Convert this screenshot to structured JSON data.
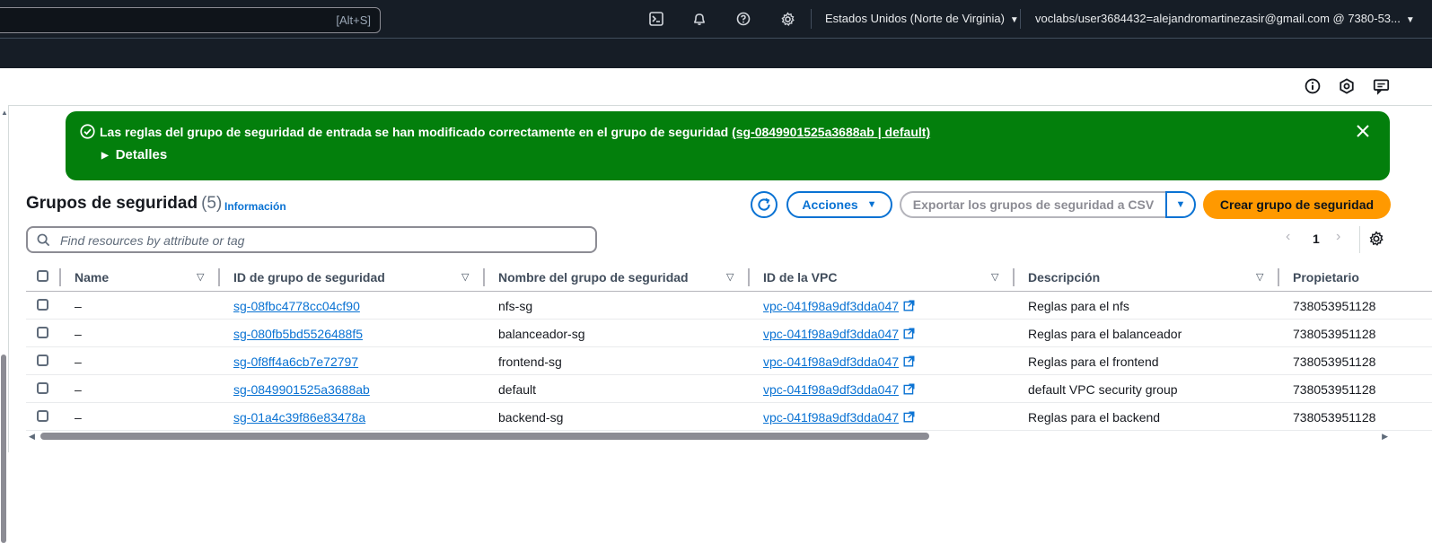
{
  "header": {
    "search_shortcut": "[Alt+S]",
    "icons": [
      "cloudshell-icon",
      "bell-icon",
      "help-icon",
      "gear-icon"
    ],
    "region": "Estados Unidos (Norte de Virginia)",
    "account": "voclabs/user3684432=alejandromartinezasir@gmail.com @ 7380-53..."
  },
  "utility_icons": [
    "info-icon",
    "hexagon-icon",
    "feedback-icon"
  ],
  "flash": {
    "message": "Las reglas del grupo de seguridad de entrada se han modificado correctamente en el grupo de seguridad",
    "link": "(sg-0849901525a3688ab | default)",
    "details": "Detalles",
    "color": "#037f0c"
  },
  "section": {
    "title": "Grupos de seguridad",
    "count": "(5)",
    "info": "Información"
  },
  "actions": {
    "acciones": "Acciones",
    "export": "Exportar los grupos de seguridad a CSV",
    "create": "Crear grupo de seguridad",
    "create_color": "#ff9900"
  },
  "filter": {
    "placeholder": "Find resources by attribute or tag"
  },
  "pagination": {
    "prev": "‹",
    "page": "1",
    "next": "›"
  },
  "table": {
    "columns": [
      "Name",
      "ID de grupo de seguridad",
      "Nombre del grupo de seguridad",
      "ID de la VPC",
      "Descripción",
      "Propietario"
    ],
    "rows": [
      {
        "name": "–",
        "id": "sg-08fbc4778cc04cf90",
        "group": "nfs-sg",
        "vpc": "vpc-041f98a9df3dda047",
        "desc": "Reglas para el nfs",
        "owner": "738053951128"
      },
      {
        "name": "–",
        "id": "sg-080fb5bd5526488f5",
        "group": "balanceador-sg",
        "vpc": "vpc-041f98a9df3dda047",
        "desc": "Reglas para el balanceador",
        "owner": "738053951128"
      },
      {
        "name": "–",
        "id": "sg-0f8ff4a6cb7e72797",
        "group": "frontend-sg",
        "vpc": "vpc-041f98a9df3dda047",
        "desc": "Reglas para el frontend",
        "owner": "738053951128"
      },
      {
        "name": "–",
        "id": "sg-0849901525a3688ab",
        "group": "default",
        "vpc": "vpc-041f98a9df3dda047",
        "desc": "default VPC security group",
        "owner": "738053951128"
      },
      {
        "name": "–",
        "id": "sg-01a4c39f86e83478a",
        "group": "backend-sg",
        "vpc": "vpc-041f98a9df3dda047",
        "desc": "Reglas para el backend",
        "owner": "738053951128"
      }
    ]
  }
}
